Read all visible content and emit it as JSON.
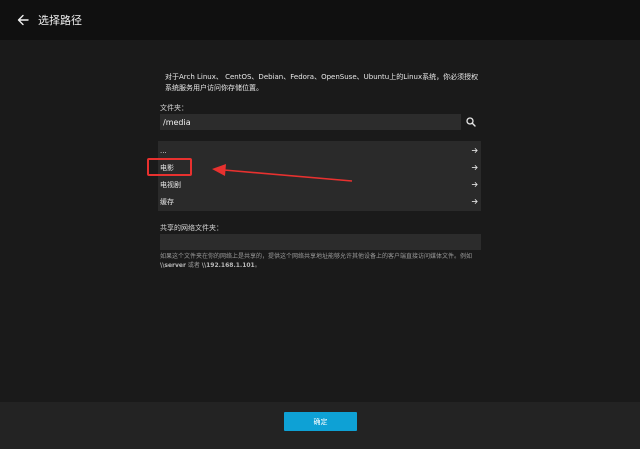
{
  "header": {
    "title": "选择路径"
  },
  "description": "对于Arch Linux、 CentOS、Debian、Fedora、OpenSuse、Ubuntu上的Linux系统，你必须授权系统服务用户访问你存储位置。",
  "folder": {
    "label": "文件夹：",
    "value": "/media"
  },
  "folder_list": [
    {
      "name": "..."
    },
    {
      "name": "电影"
    },
    {
      "name": "电视剧"
    },
    {
      "name": "缓存"
    }
  ],
  "share": {
    "label": "共享的网络文件夹：",
    "value": "",
    "help_prefix": "如果这个文件夹在你的网络上是共享的，提供这个网络共享地址能够允许其他设备上的客户端直接访问媒体文件。例如 ",
    "help_example1": "\\\\server",
    "help_or": " 或者 ",
    "help_example2": "\\\\192.168.1.101",
    "help_suffix": "。"
  },
  "footer": {
    "ok_label": "确定"
  },
  "colors": {
    "accent": "#0ea1d5",
    "annotation": "#e8312f"
  },
  "icons": {
    "back": "arrow-left-icon",
    "search": "search-icon",
    "item_arrow": "arrow-right-icon"
  }
}
